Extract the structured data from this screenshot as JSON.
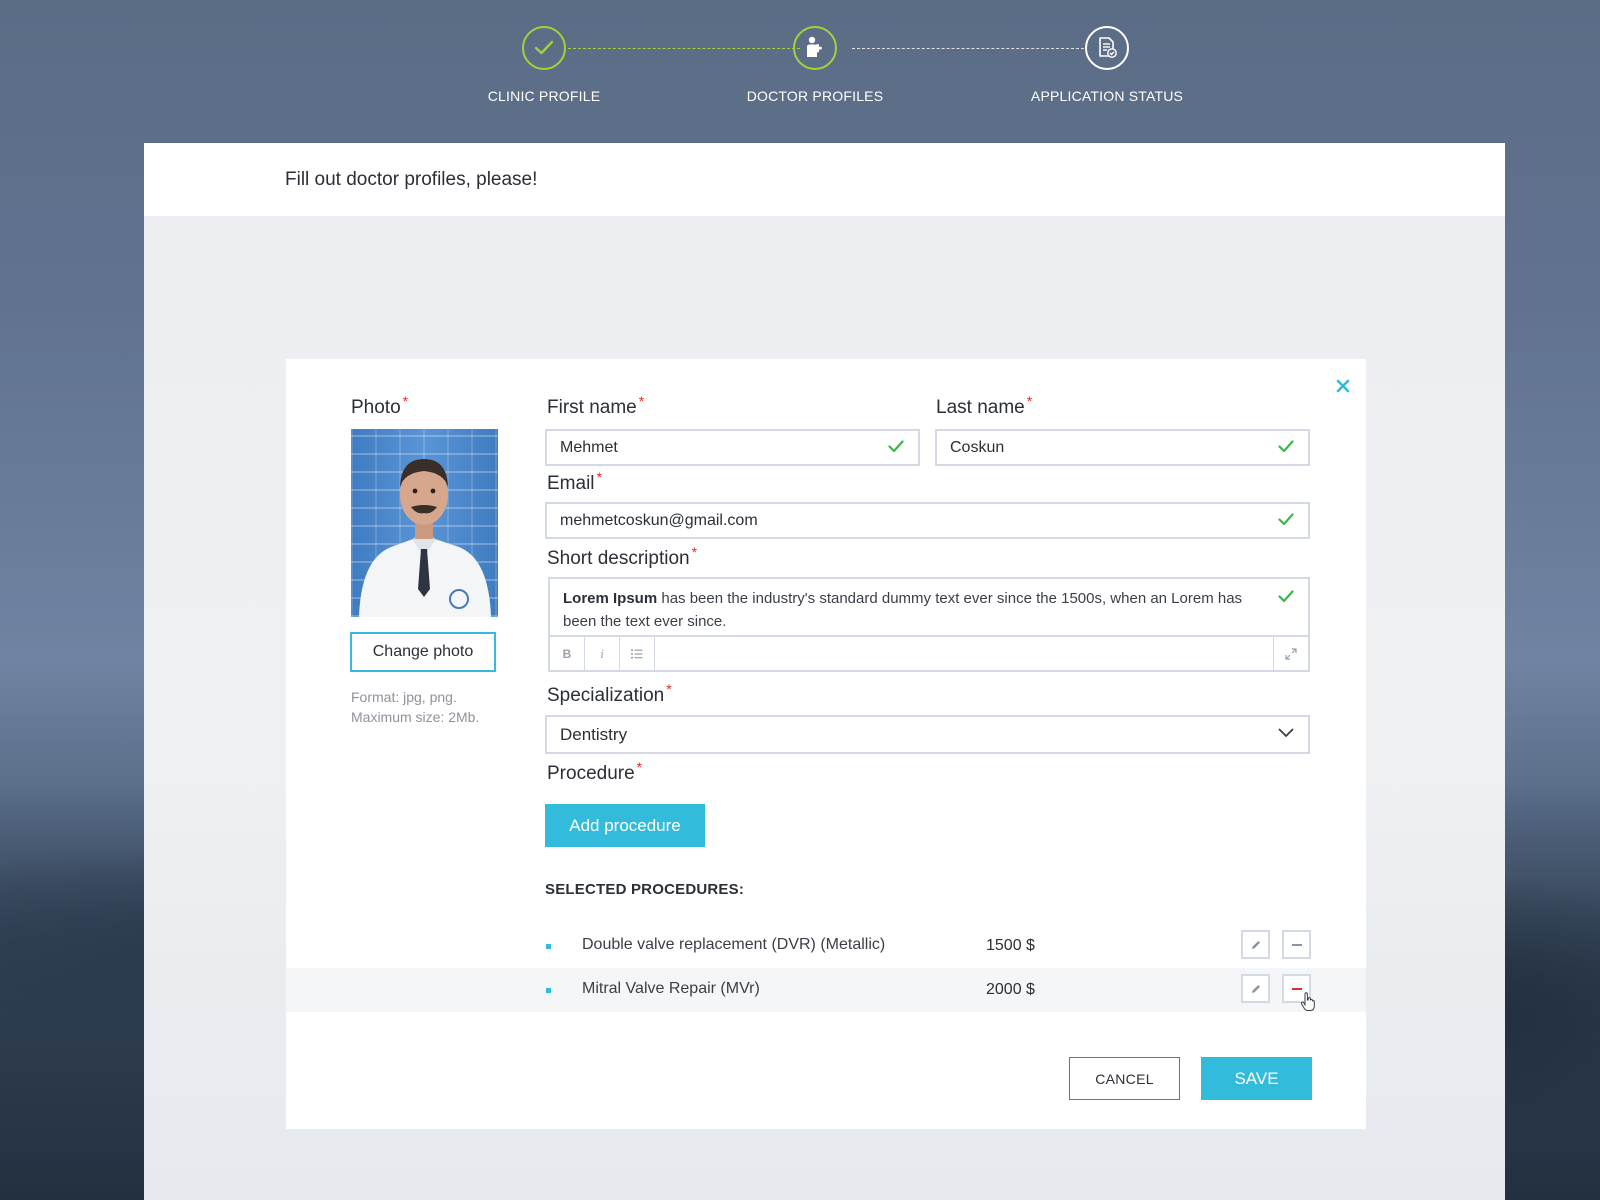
{
  "colors": {
    "accent": "#33bbdc",
    "success": "#9fd23c",
    "check": "#3cb54a",
    "required": "#e52b2b",
    "remove": "#e52b2b"
  },
  "stepper": {
    "steps": [
      {
        "label": "CLINIC PROFILE",
        "state": "done",
        "icon": "check-icon"
      },
      {
        "label": "DOCTOR PROFILES",
        "state": "active",
        "icon": "doctor-icon"
      },
      {
        "label": "APPLICATION STATUS",
        "state": "pending",
        "icon": "document-icon"
      }
    ]
  },
  "panel": {
    "title": "Fill out doctor profiles, please!"
  },
  "form": {
    "required_mark": "*",
    "photo": {
      "label": "Photo",
      "change_button": "Change photo",
      "hint_format": "Format: jpg, png.",
      "hint_size": "Maximum size: 2Mb."
    },
    "first_name": {
      "label": "First name",
      "value": "Mehmet",
      "valid": true
    },
    "last_name": {
      "label": "Last name",
      "value": "Coskun",
      "valid": true
    },
    "email": {
      "label": "Email",
      "value": "mehmetcoskun@gmail.com",
      "valid": true
    },
    "short_description": {
      "label": "Short description",
      "bold_lead": "Lorem Ipsum",
      "text": " has been the industry's standard dummy text ever since the 1500s, when an Lorem has been the text ever since.",
      "toolbar": {
        "bold": "B",
        "italic": "i"
      },
      "valid": true
    },
    "specialization": {
      "label": "Specialization",
      "value": "Dentistry"
    },
    "procedure": {
      "label": "Procedure",
      "add_button": "Add procedure",
      "selected_heading": "SELECTED PROCEDURES:",
      "items": [
        {
          "name": "Double valve replacement (DVR) (Metallic)",
          "price": "1500 $"
        },
        {
          "name": "Mitral Valve Repair (MVr)",
          "price": "2000 $"
        }
      ]
    }
  },
  "actions": {
    "cancel": "CANCEL",
    "save": "SAVE"
  }
}
